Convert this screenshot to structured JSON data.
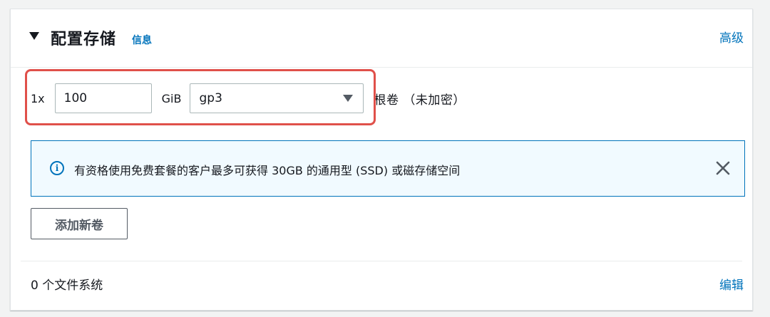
{
  "header": {
    "title": "配置存储",
    "info_link": "信息",
    "advanced_link": "高级"
  },
  "volume": {
    "count_label": "1x",
    "size_value": "100",
    "unit_label": "GiB",
    "type_selected": "gp3",
    "description": "根卷 （未加密）"
  },
  "alert": {
    "icon": "info-icon",
    "text": "有资格使用免费套餐的客户最多可获得 30GB 的通用型 (SSD) 或磁存储空间"
  },
  "buttons": {
    "add_volume": "添加新卷"
  },
  "file_systems": {
    "count_text": "0 个文件系统",
    "edit_link": "编辑"
  },
  "colors": {
    "link": "#0073bb",
    "highlight": "#e0504a",
    "alert_bg": "#f1faff"
  }
}
